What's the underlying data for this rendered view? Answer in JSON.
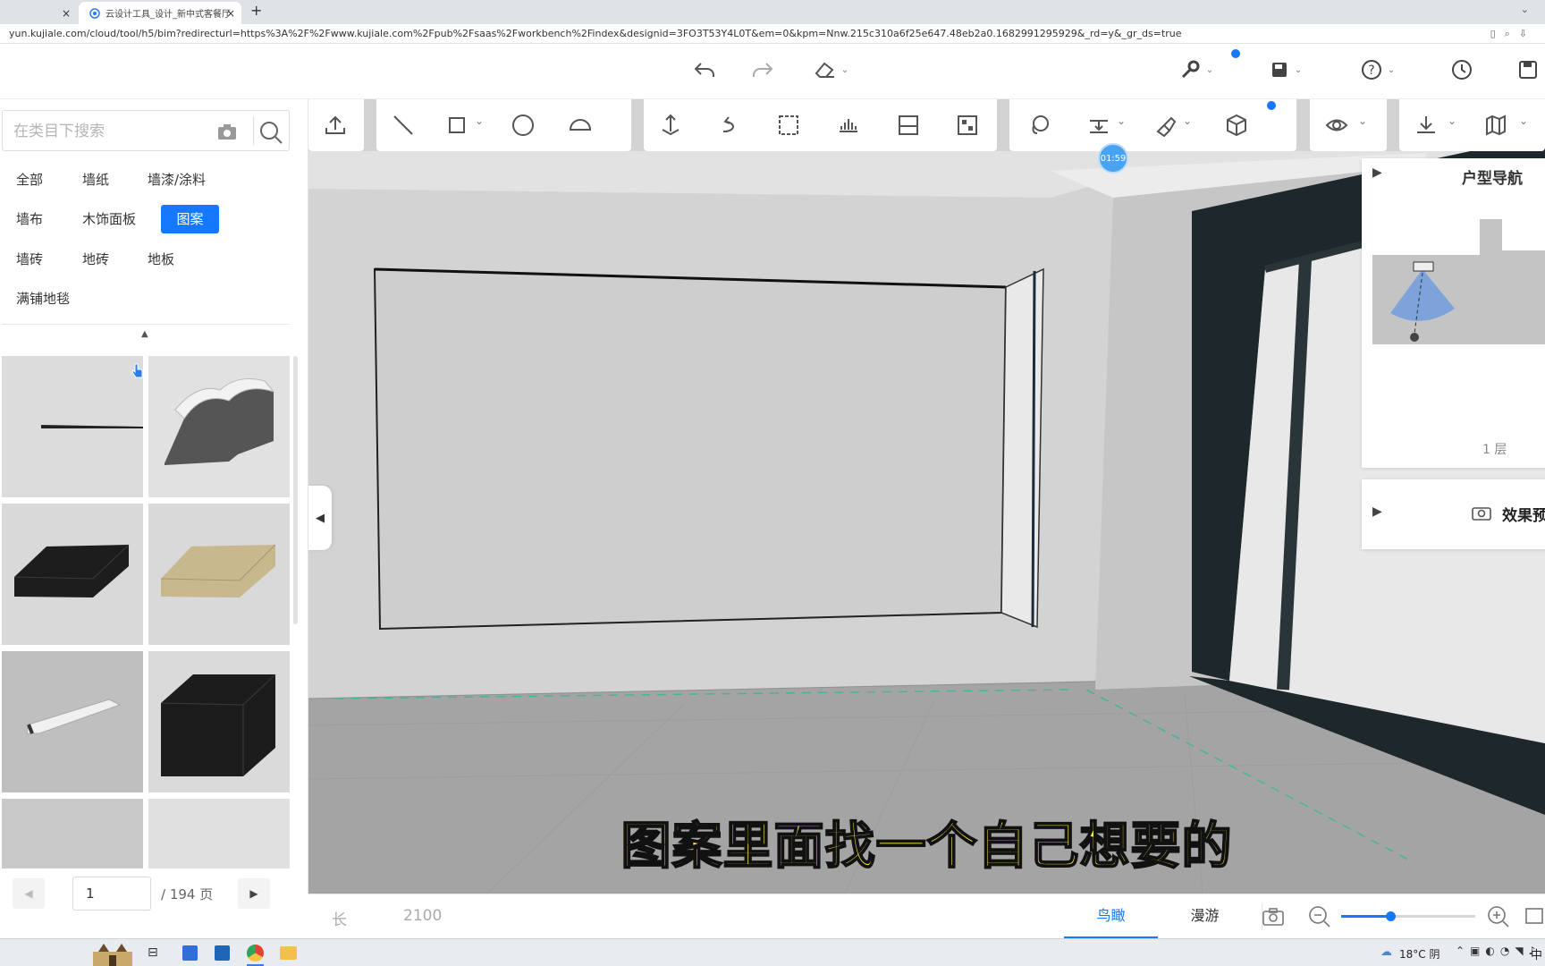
{
  "browser": {
    "tab1_close": "×",
    "tab2_title": "云设计工具_设计_新中式客餐厅",
    "tab2_close": "×",
    "new_tab": "+",
    "address": "yun.kujiale.com/cloud/tool/h5/bim?redirecturl=https%3A%2F%2Fwww.kujiale.com%2Fpub%2Fsaas%2Fworkbench%2Findex&designid=3FO3T53Y4L0T&em=0&kpm=Nnw.215c310a6f25e647.48eb2a0.1682991295929&_rd=y&_gr_ds=true"
  },
  "left": {
    "search_placeholder": "在类目下搜索",
    "categories": [
      {
        "label": "全部"
      },
      {
        "label": "墙纸"
      },
      {
        "label": "墙漆/涂料"
      },
      {
        "label": "墙布"
      },
      {
        "label": "木饰面板"
      },
      {
        "label": "图案",
        "active": true
      },
      {
        "label": "墙砖"
      },
      {
        "label": "地砖"
      },
      {
        "label": "地板"
      },
      {
        "label": "满铺地毯"
      }
    ],
    "pager": {
      "current": "1",
      "total_label": "/ 194 页"
    }
  },
  "viewport": {
    "timer": "01:59",
    "nav_title": "户型导航",
    "floor": "1 层",
    "preview_title": "效果预",
    "subtitle": "图案里面找一个自己想要的"
  },
  "bottom": {
    "length_label": "长",
    "length_value": "2100",
    "tab_birdseye": "鸟瞰",
    "tab_roam": "漫游"
  },
  "taskbar": {
    "weather": "18°C 阴",
    "ime": "中"
  },
  "colors": {
    "accent": "#1677ff",
    "subtitle": "#ffe94d"
  }
}
